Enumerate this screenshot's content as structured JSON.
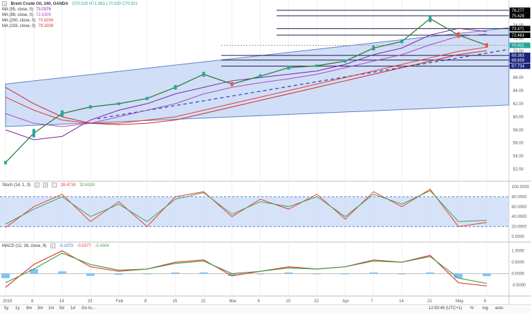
{
  "header": {
    "symbol": "Brent Crude Oil, 240, OANDA",
    "ohlc": "O70.520  H71.063  L70.520  C70.921",
    "mas": [
      {
        "label": "MA (55, close, 0)",
        "value": "73.0376",
        "color": "#7b1fa2"
      },
      {
        "label": "MA (89, close, 0)",
        "value": "72.6309",
        "color": "#ab47bc"
      },
      {
        "label": "MA (200, close, 0)",
        "value": "70.6299",
        "color": "#e53935"
      },
      {
        "label": "MA (233, close, 0)",
        "value": "70.1039",
        "color": "#c62828"
      }
    ]
  },
  "stoch_label": {
    "title": "Stoch (14, 1, 3)",
    "k": "28.4716",
    "d": "32.6159"
  },
  "macd_label": {
    "title": "MACD (12, 26, close, 9)",
    "hist": "-0.1073",
    "macd": "-0.5377",
    "signal": "-0.4304"
  },
  "price_axis": [
    "76.00",
    "74.00",
    "72.00",
    "70.00",
    "68.00",
    "66.00",
    "64.00",
    "62.00",
    "60.00",
    "58.00",
    "56.00",
    "54.00",
    "52.00"
  ],
  "price_tags": [
    {
      "value": "76.277",
      "bg": "#000000"
    },
    {
      "value": "75.429",
      "bg": "#000000"
    },
    {
      "value": "73.471",
      "bg": "#000000"
    },
    {
      "value": "72.463",
      "bg": "#000000"
    },
    {
      "value": "70.921",
      "bg": "#26a69a"
    },
    {
      "value": "69.383",
      "bg": "#1a237e"
    },
    {
      "value": "68.659",
      "bg": "#1a237e"
    },
    {
      "value": "67.734",
      "bg": "#1a237e"
    }
  ],
  "stoch_axis": [
    "100.0000",
    "80.0000",
    "60.0000",
    "40.0000",
    "20.0000",
    "0.0000"
  ],
  "macd_axis": [
    "1.0000",
    "0.5000",
    "0.0000",
    "-0.5000"
  ],
  "time_axis": [
    "2019",
    "8",
    "14",
    "23",
    "Feb",
    "8",
    "15",
    "22",
    "Mar",
    "6",
    "15",
    "22",
    "Apr",
    "7",
    "14",
    "22",
    "May",
    "6"
  ],
  "bottom_bar": {
    "timeframes": [
      "5y",
      "1y",
      "6m",
      "3m",
      "1m",
      "5d",
      "1d",
      "Go to..."
    ],
    "clock": "12:50:45 (UTC+1)",
    "toggles": [
      "%",
      "log",
      "auto"
    ]
  },
  "chart_data": {
    "type": "line",
    "title": "Brent Crude Oil, 240, OANDA",
    "series": [
      {
        "name": "Price",
        "x": [
          "2019",
          "8",
          "14",
          "23",
          "Feb",
          "8",
          "15",
          "22",
          "Mar",
          "6",
          "15",
          "22",
          "Apr",
          "7",
          "14",
          "22",
          "May",
          "6"
        ],
        "values": [
          53.0,
          57.5,
          60.5,
          61.5,
          62.0,
          62.8,
          64.5,
          66.5,
          65.0,
          66.2,
          67.5,
          67.8,
          68.5,
          70.5,
          71.5,
          75.0,
          72.5,
          70.92
        ]
      },
      {
        "name": "MA (55, close, 0)",
        "values": [
          58.0,
          56.5,
          57.0,
          59.5,
          61.0,
          62.0,
          63.5,
          64.5,
          65.5,
          66.0,
          66.5,
          67.0,
          68.0,
          69.5,
          70.5,
          72.5,
          73.5,
          73.04
        ]
      },
      {
        "name": "MA (89, close, 0)",
        "values": [
          60.5,
          59.0,
          58.5,
          59.0,
          60.0,
          61.0,
          62.0,
          63.5,
          64.5,
          65.2,
          65.8,
          66.5,
          67.5,
          68.5,
          69.5,
          71.0,
          72.3,
          72.63
        ]
      },
      {
        "name": "MA (200, close, 0)",
        "values": [
          63.0,
          61.0,
          59.5,
          59.0,
          59.0,
          59.5,
          60.0,
          61.0,
          62.0,
          63.0,
          64.0,
          65.0,
          66.0,
          67.0,
          68.0,
          69.0,
          70.0,
          70.63
        ]
      },
      {
        "name": "MA (233, close, 0)",
        "values": [
          64.5,
          62.0,
          60.0,
          59.0,
          58.8,
          59.0,
          59.5,
          60.5,
          61.5,
          62.5,
          63.5,
          64.5,
          65.5,
          66.5,
          67.5,
          68.5,
          69.5,
          70.1
        ]
      }
    ],
    "ylim": [
      51,
      77
    ],
    "channel": {
      "upper": [
        65.0,
        73.6
      ],
      "lower": [
        58.5,
        61.8
      ]
    },
    "stoch": {
      "k": [
        18,
        60,
        85,
        30,
        70,
        20,
        80,
        90,
        40,
        75,
        55,
        85,
        35,
        90,
        60,
        95,
        20,
        28.47
      ],
      "d": [
        25,
        55,
        80,
        40,
        65,
        30,
        75,
        88,
        45,
        70,
        60,
        80,
        40,
        85,
        65,
        92,
        30,
        32.62
      ],
      "ylim": [
        0,
        100
      ],
      "bands": [
        20,
        80
      ]
    },
    "macd": {
      "macd": [
        -0.6,
        0.4,
        1.0,
        0.3,
        0.1,
        0.2,
        0.5,
        0.6,
        -0.1,
        0.1,
        0.3,
        0.2,
        0.3,
        0.6,
        0.5,
        0.8,
        -0.4,
        -0.54
      ],
      "signal": [
        -0.4,
        0.2,
        0.9,
        0.4,
        0.15,
        0.2,
        0.45,
        0.55,
        0.0,
        0.1,
        0.25,
        0.2,
        0.3,
        0.55,
        0.5,
        0.75,
        -0.2,
        -0.43
      ],
      "ylim": [
        -0.8,
        1.2
      ]
    },
    "grid": true
  }
}
